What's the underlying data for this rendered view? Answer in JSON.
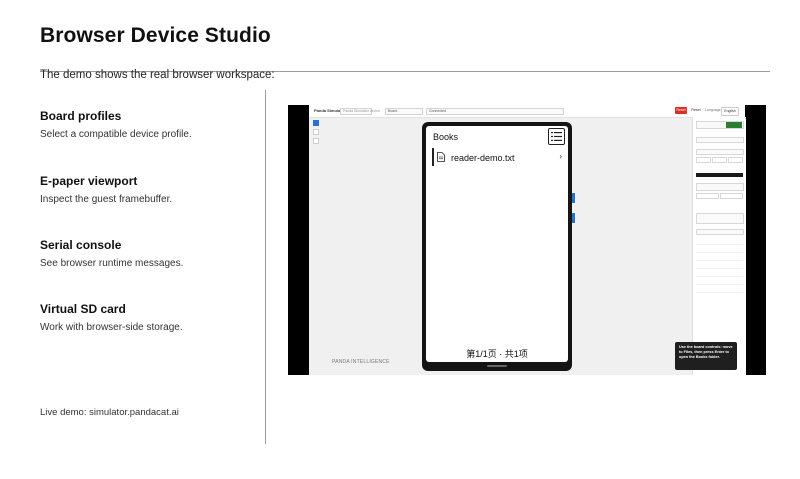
{
  "page": {
    "title": "Browser Device Studio",
    "subtitle": "The demo shows the real browser workspace:",
    "features": [
      {
        "heading": "Board profiles",
        "text": "Select a compatible device profile."
      },
      {
        "heading": "E-paper viewport",
        "text": "Inspect the guest framebuffer."
      },
      {
        "heading": "Serial console",
        "text": "See browser runtime messages."
      },
      {
        "heading": "Virtual SD card",
        "text": "Work with browser-side storage."
      }
    ],
    "live_demo": "Live demo: simulator.pandacat.ai"
  },
  "screenshot": {
    "app_name": "Panda Simulator",
    "app_tagline": "Panda Simulator device",
    "board_select": "Board",
    "status_field": "Connected",
    "toolbar_buttons": [
      "Reset",
      "Reset",
      "Language",
      "English"
    ],
    "brand_footer": "PANDA INTELLIGENCE",
    "device": {
      "list_title": "Books",
      "file_name": "reader-demo.txt",
      "chevron": "›",
      "pager": "第1/1页 · 共1项"
    },
    "toast": "Use the board controls: move to Files, then press Enter to open the Books folder.",
    "colors": {
      "accent": "#2a6fd6",
      "danger": "#d93025",
      "success": "#2e7d32"
    }
  }
}
